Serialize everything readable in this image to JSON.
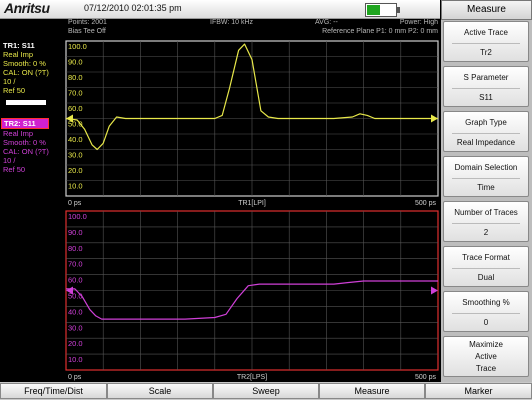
{
  "header": {
    "brand": "Anritsu",
    "datetime": "07/12/2010 02:01:35 pm",
    "battery_level": 0.45,
    "colors": {
      "battery": "#1fa51f"
    }
  },
  "status": {
    "points": "Points: 2001",
    "bias_tee": "Bias Tee Off",
    "ifbw": "IFBW: 10 kHz",
    "avg": "AVG: --",
    "power": "Power: High",
    "ref_plane": "Reference Plane P1: 0 mm P2: 0 mm"
  },
  "trace1_info": {
    "title": "TR1: S11",
    "lines": [
      "Real Imp",
      "Smooth: 0 %",
      "CAL: ON (?T)",
      "10 /",
      "Ref 50"
    ],
    "color": "#e8e84a"
  },
  "trace2_info": {
    "title": "TR2: S11",
    "lines": [
      "Real Imp",
      "Smooth: 0 %",
      "CAL: ON (?T)",
      "10 /",
      "Ref 50"
    ],
    "color": "#d040d8"
  },
  "menu": {
    "title": "Measure",
    "buttons": [
      {
        "label": "Active Trace",
        "value": "Tr2"
      },
      {
        "label": "S Parameter",
        "value": "S11"
      },
      {
        "label": "Graph Type",
        "value": "Real Impedance"
      },
      {
        "label": "Domain Selection",
        "value": "Time"
      },
      {
        "label": "Number of Traces",
        "value": "2"
      },
      {
        "label": "Trace Format",
        "value": "Dual"
      },
      {
        "label": "Smoothing %",
        "value": "0"
      },
      {
        "label": "Maximize",
        "value": "Active",
        "value2": "Trace"
      }
    ]
  },
  "softkeys": [
    "Freq/Time/Dist",
    "Scale",
    "Sweep",
    "Measure",
    "Marker"
  ],
  "chart_data": [
    {
      "type": "line",
      "name_label": "TR1[LPI]",
      "xlabel_left": "0 ps",
      "xlabel_right": "500 ps",
      "ylim": [
        0,
        100
      ],
      "yticks": [
        "100.0",
        "90.0",
        "80.0",
        "70.0",
        "60.0",
        "50.0",
        "40.0",
        "30.0",
        "20.0",
        "10.0"
      ],
      "reference": 50,
      "color": "#e8e84a",
      "grid": true,
      "x": [
        0,
        15,
        25,
        35,
        42,
        50,
        58,
        68,
        80,
        100,
        120,
        150,
        180,
        200,
        210,
        220,
        232,
        240,
        250,
        262,
        272,
        285,
        300,
        330,
        360,
        385,
        395,
        405,
        415,
        430,
        460,
        490,
        500
      ],
      "y": [
        50,
        49,
        43,
        33,
        30,
        34,
        45,
        51,
        50,
        50,
        50,
        50,
        50,
        50,
        52,
        70,
        94,
        98,
        88,
        55,
        51,
        50,
        50,
        50,
        50,
        51,
        53,
        52,
        50,
        50,
        50,
        50,
        50
      ]
    },
    {
      "type": "line",
      "name_label": "TR2[LPS]",
      "xlabel_left": "0 ps",
      "xlabel_right": "500 ps",
      "ylim": [
        0,
        100
      ],
      "yticks": [
        "100.0",
        "90.0",
        "80.0",
        "70.0",
        "60.0",
        "50.0",
        "40.0",
        "30.0",
        "20.0",
        "10.0"
      ],
      "reference": 50,
      "color": "#d040d8",
      "grid": true,
      "x": [
        0,
        12,
        22,
        32,
        40,
        48,
        60,
        80,
        120,
        160,
        200,
        215,
        230,
        245,
        260,
        280,
        320,
        360,
        380,
        400,
        430,
        460,
        490,
        500
      ],
      "y": [
        51,
        51,
        46,
        38,
        34,
        32,
        32,
        32,
        32,
        32,
        33,
        35,
        45,
        53,
        54,
        54,
        54,
        54,
        55,
        56,
        56,
        56,
        56,
        56
      ]
    }
  ]
}
